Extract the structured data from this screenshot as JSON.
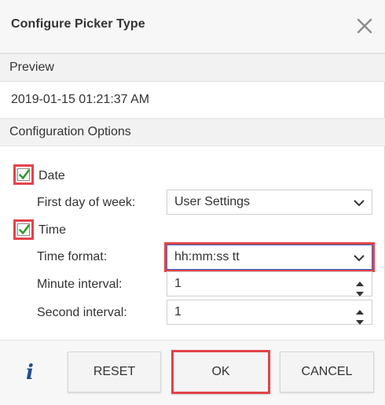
{
  "dialog": {
    "title": "Configure Picker Type"
  },
  "preview": {
    "header": "Preview",
    "value": "2019-01-15 01:21:37 AM"
  },
  "options": {
    "header": "Configuration Options",
    "date": {
      "label": "Date",
      "checked": true,
      "first_day_label": "First day of week:",
      "first_day_value": "User Settings"
    },
    "time": {
      "label": "Time",
      "checked": true,
      "format_label": "Time format:",
      "format_value": "hh:mm:ss tt",
      "minute_label": "Minute interval:",
      "minute_value": "1",
      "second_label": "Second interval:",
      "second_value": "1"
    }
  },
  "footer": {
    "info_glyph": "i",
    "reset_label": "RESET",
    "ok_label": "OK",
    "cancel_label": "CANCEL"
  },
  "colors": {
    "highlight": "#e2434a",
    "check": "#2e9b2e",
    "focus": "#2b6ad1",
    "info": "#1f4e8c"
  }
}
